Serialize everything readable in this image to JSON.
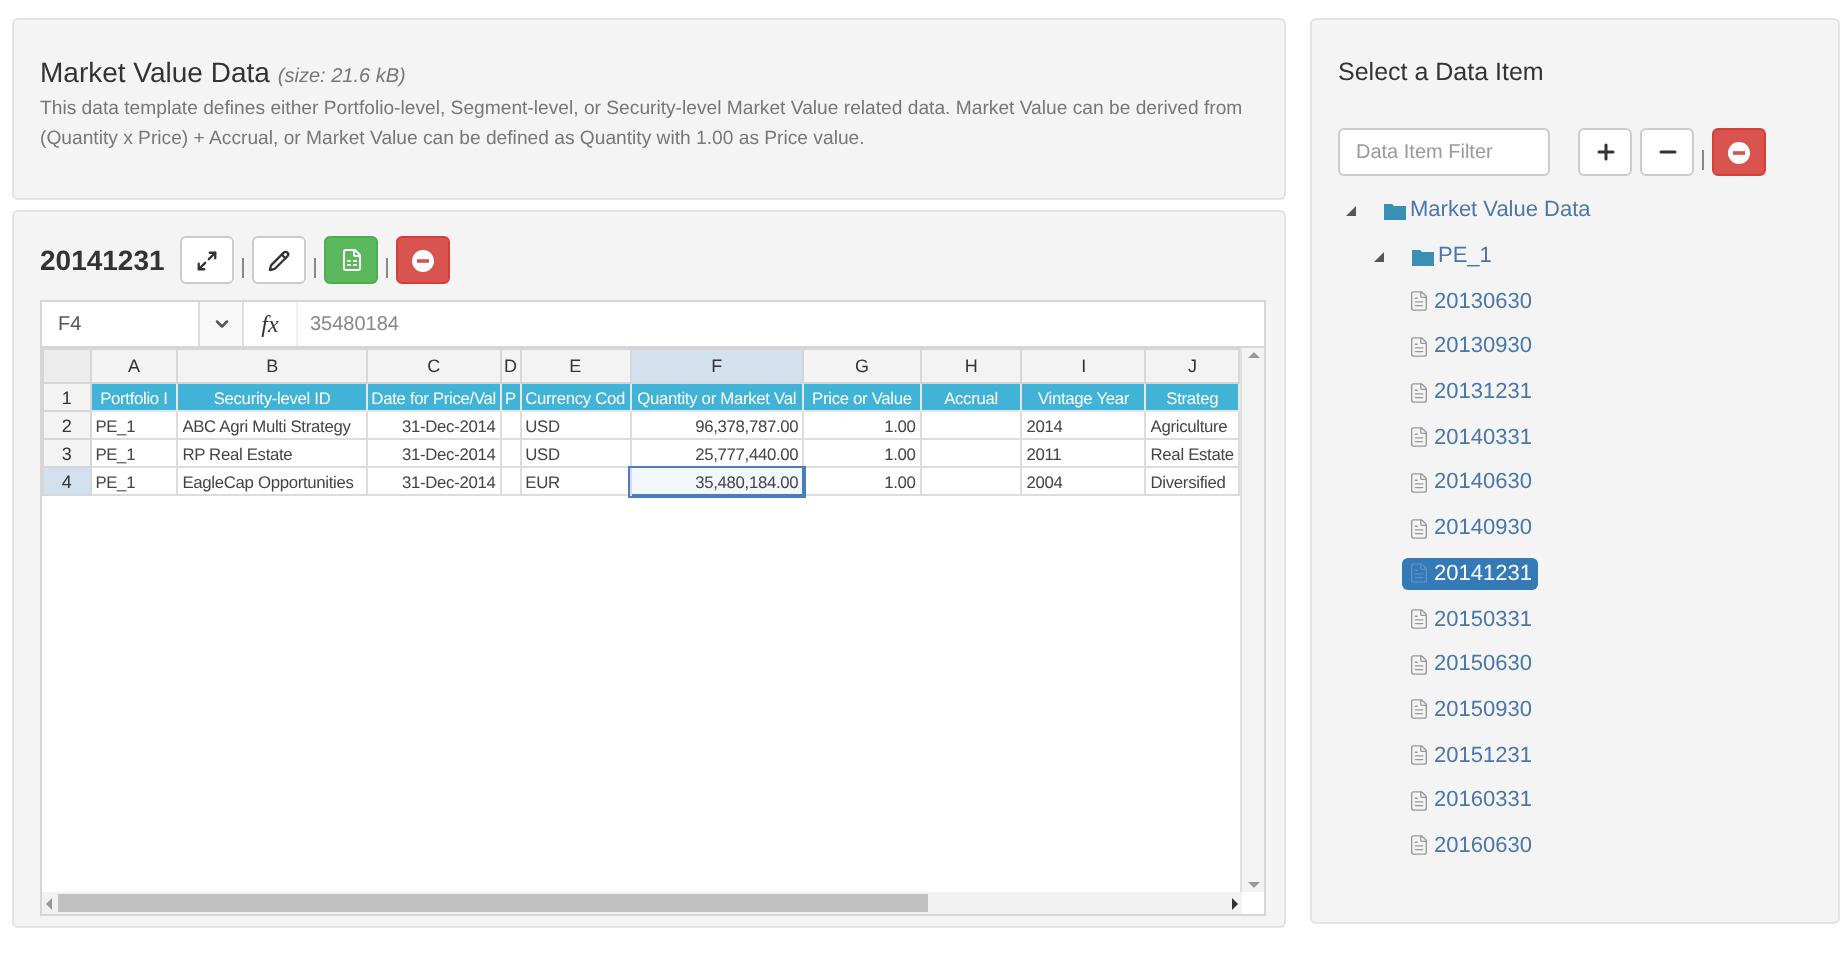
{
  "info": {
    "title": "Market Value Data",
    "size": "(size: 21.6 kB)",
    "description": "This data template defines either Portfolio-level, Segment-level, or Security-level Market Value related data. Market Value can be derived from (Quantity x Price) + Accrual, or Market Value can be defined as Quantity with 1.00 as Price value."
  },
  "editor": {
    "title": "20141231",
    "buttons": [
      {
        "kind": "expand"
      },
      {
        "kind": "edit"
      },
      {
        "kind": "excel"
      },
      {
        "kind": "remove"
      }
    ]
  },
  "sheet": {
    "cell_ref": "F4",
    "formula_label": "fx",
    "formula": "35480184",
    "columns": [
      {
        "letter": "A",
        "kind": "text",
        "selected": false
      },
      {
        "letter": "B",
        "kind": "text",
        "selected": false
      },
      {
        "letter": "C",
        "kind": "number",
        "selected": false
      },
      {
        "letter": "D",
        "kind": "text",
        "selected": false
      },
      {
        "letter": "E",
        "kind": "text",
        "selected": false
      },
      {
        "letter": "F",
        "kind": "number",
        "selected": true
      },
      {
        "letter": "G",
        "kind": "number",
        "selected": false
      },
      {
        "letter": "H",
        "kind": "number",
        "selected": false
      },
      {
        "letter": "I",
        "kind": "text",
        "selected": false
      },
      {
        "letter": "J",
        "kind": "text",
        "selected": false
      }
    ],
    "header": {
      "number": "1",
      "cells": [
        "Portfolio I",
        "Security-level ID",
        "Date for Price/Val",
        "P",
        "Currency Cod",
        "Quantity or Market Val",
        "Price or Value",
        "Accrual",
        "Vintage Year",
        "Strateg"
      ]
    },
    "rows": [
      {
        "number": "2",
        "selected": false,
        "cells": [
          "PE_1",
          "ABC Agri Multi Strategy",
          "31-Dec-2014",
          "",
          "USD",
          "96,378,787.00",
          "1.00",
          "",
          "2014",
          "Agriculture"
        ]
      },
      {
        "number": "3",
        "selected": false,
        "cells": [
          "PE_1",
          "RP Real Estate",
          "31-Dec-2014",
          "",
          "USD",
          "25,777,440.00",
          "1.00",
          "",
          "2011",
          "Real Estate"
        ]
      },
      {
        "number": "4",
        "selected": true,
        "cells": [
          "PE_1",
          "EagleCap Opportunities",
          "31-Dec-2014",
          "",
          "EUR",
          "35,480,184.00",
          "1.00",
          "",
          "2004",
          "Diversified"
        ]
      }
    ]
  },
  "tree": {
    "title": "Select a Data Item",
    "filter_placeholder": "Data Item Filter",
    "buttons": [
      {
        "kind": "expand-all"
      },
      {
        "kind": "collapse-all"
      },
      {
        "kind": "remove"
      }
    ],
    "items": [
      {
        "label": "Market Value Data",
        "kind": "folder",
        "expanded": true,
        "children": [
          {
            "label": "PE_1",
            "kind": "folder",
            "expanded": true,
            "children": [
              {
                "label": "20130630",
                "kind": "file",
                "selected": false
              },
              {
                "label": "20130930",
                "kind": "file",
                "selected": false
              },
              {
                "label": "20131231",
                "kind": "file",
                "selected": false
              },
              {
                "label": "20140331",
                "kind": "file",
                "selected": false
              },
              {
                "label": "20140630",
                "kind": "file",
                "selected": false
              },
              {
                "label": "20140930",
                "kind": "file",
                "selected": false
              },
              {
                "label": "20141231",
                "kind": "file",
                "selected": true
              },
              {
                "label": "20150331",
                "kind": "file",
                "selected": false
              },
              {
                "label": "20150630",
                "kind": "file",
                "selected": false
              },
              {
                "label": "20150930",
                "kind": "file",
                "selected": false
              },
              {
                "label": "20151231",
                "kind": "file",
                "selected": false
              },
              {
                "label": "20160331",
                "kind": "file",
                "selected": false
              },
              {
                "label": "20160630",
                "kind": "file",
                "selected": false
              }
            ]
          }
        ]
      }
    ]
  }
}
